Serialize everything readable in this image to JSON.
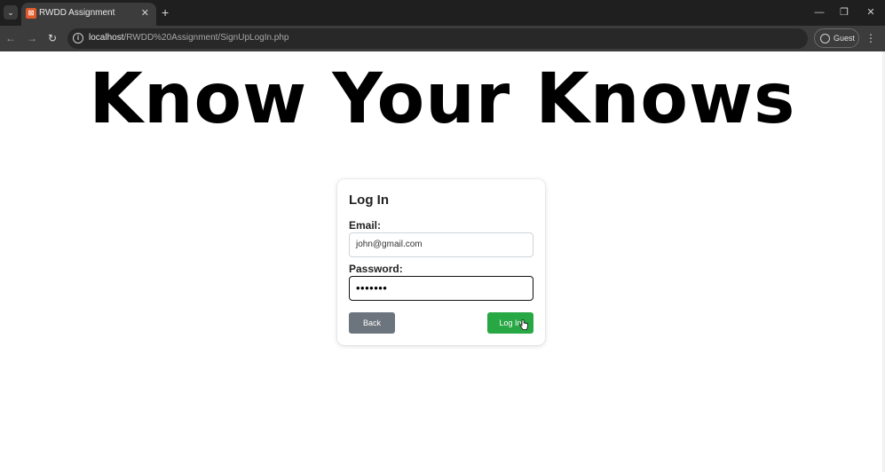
{
  "browser": {
    "tab": {
      "title": "RWDD Assignment",
      "favicon": "xampp-icon",
      "close": "✕"
    },
    "new_tab": "+",
    "window": {
      "minimize": "—",
      "restore": "❐",
      "close": "✕"
    },
    "nav": {
      "back": "←",
      "forward": "→",
      "reload": "↻"
    },
    "url": {
      "host": "localhost",
      "path": "/RWDD%20Assignment/SignUpLogIn.php"
    },
    "profile_label": "Guest",
    "menu": "⋮",
    "tab_search": "⌄"
  },
  "page": {
    "headline": "Know Your Knows",
    "login_card": {
      "title": "Log In",
      "email_label": "Email:",
      "email_value": "john@gmail.com",
      "password_label": "Password:",
      "password_value": "•••••••",
      "back_label": "Back",
      "login_label": "Log In"
    }
  },
  "colors": {
    "back_button": "#6c757d",
    "login_button": "#28a745",
    "browser_frame": "#1f1f1f",
    "toolbar": "#3c3c3c"
  }
}
